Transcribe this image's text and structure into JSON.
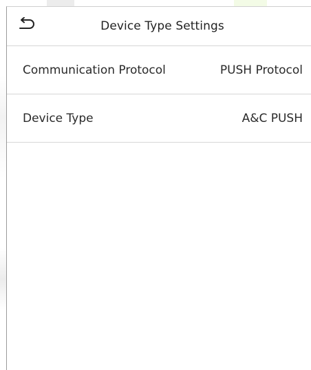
{
  "header": {
    "title": "Device Type Settings",
    "back_icon": "back-arrow-icon"
  },
  "settings": [
    {
      "label": "Communication Protocol",
      "value": "PUSH Protocol"
    },
    {
      "label": "Device Type",
      "value": "A&C PUSH"
    }
  ],
  "colors": {
    "background": "#ffffff",
    "text": "#222222",
    "divider": "#d6d6d6"
  }
}
